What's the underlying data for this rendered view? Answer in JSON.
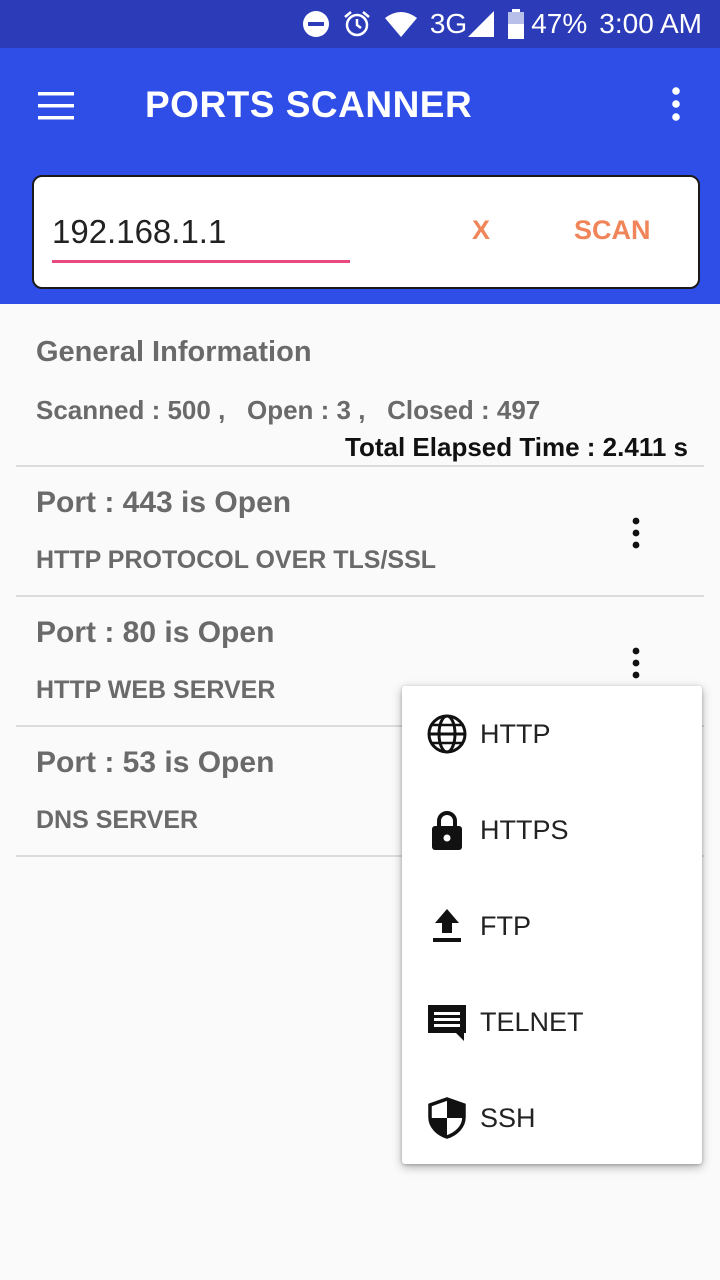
{
  "status_bar": {
    "battery": "47%",
    "time": "3:00 AM",
    "network": "3G",
    "icons": [
      "do-not-disturb-icon",
      "alarm-icon",
      "wifi-icon",
      "signal-icon",
      "battery-icon"
    ]
  },
  "app_bar": {
    "title": "PORTS SCANNER",
    "menu_icon": "hamburger-menu-icon",
    "overflow_icon": "more-vert-icon"
  },
  "search": {
    "value": "192.168.1.1",
    "clear_label": "X",
    "scan_label": "SCAN"
  },
  "general": {
    "title": "General Information",
    "stats": "Scanned : 500 ,   Open : 3 ,   Closed : 497",
    "elapsed": "Total Elapsed Time : 2.411 s"
  },
  "ports": [
    {
      "title": "Port : 443 is Open",
      "desc": "HTTP PROTOCOL OVER TLS/SSL"
    },
    {
      "title": "Port : 80 is Open",
      "desc": "HTTP WEB SERVER"
    },
    {
      "title": "Port : 53 is Open",
      "desc": "DNS SERVER"
    }
  ],
  "popup_menu": [
    {
      "label": "HTTP",
      "icon": "globe-icon"
    },
    {
      "label": "HTTPS",
      "icon": "lock-icon"
    },
    {
      "label": "FTP",
      "icon": "upload-icon"
    },
    {
      "label": "TELNET",
      "icon": "chat-icon"
    },
    {
      "label": "SSH",
      "icon": "shield-icon"
    }
  ],
  "colors": {
    "status_bar": "#2c3cb8",
    "app_bar": "#2f4ee8",
    "accent": "#f0855a",
    "underline": "#e84a7f"
  }
}
